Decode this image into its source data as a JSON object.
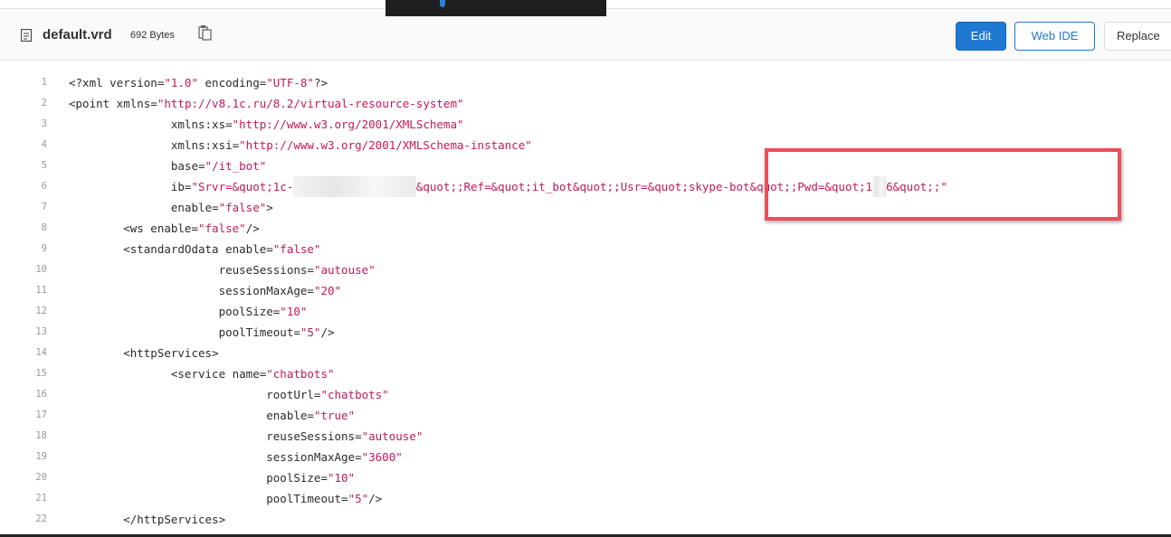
{
  "file": {
    "name": "default.vrd",
    "size": "692 Bytes",
    "icons": {
      "file": "file-icon",
      "copy": "copy-icon"
    }
  },
  "actions": {
    "edit": "Edit",
    "web_ide": "Web IDE",
    "replace": "Replace"
  },
  "colors": {
    "accent": "#1f78d1",
    "string": "#c2185b",
    "highlight": "#e8505b"
  },
  "lines": [
    {
      "n": "1",
      "t": "<?xml version=\"1.0\" encoding=\"UTF-8\"?>"
    },
    {
      "n": "2",
      "t": "<point xmlns=\"http://v8.1c.ru/8.2/virtual-resource-system\""
    },
    {
      "n": "3",
      "t": "               xmlns:xs=\"http://www.w3.org/2001/XMLSchema\""
    },
    {
      "n": "4",
      "t": "               xmlns:xsi=\"http://www.w3.org/2001/XMLSchema-instance\""
    },
    {
      "n": "5",
      "t": "               base=\"/it_bot\""
    },
    {
      "n": "6",
      "t": "               ib=\"Srvr=&quot;1c-"
    },
    {
      "n": "7",
      "t": "               enable=\"false\">"
    },
    {
      "n": "8",
      "t": "        <ws enable=\"false\"/>"
    },
    {
      "n": "9",
      "t": "        <standardOdata enable=\"false\""
    },
    {
      "n": "10",
      "t": "                      reuseSessions=\"autouse\""
    },
    {
      "n": "11",
      "t": "                      sessionMaxAge=\"20\""
    },
    {
      "n": "12",
      "t": "                      poolSize=\"10\""
    },
    {
      "n": "13",
      "t": "                      poolTimeout=\"5\"/>"
    },
    {
      "n": "14",
      "t": "        <httpServices>"
    },
    {
      "n": "15",
      "t": "               <service name=\"chatbots\""
    },
    {
      "n": "16",
      "t": "                             rootUrl=\"chatbots\""
    },
    {
      "n": "17",
      "t": "                             enable=\"true\""
    },
    {
      "n": "18",
      "t": "                             reuseSessions=\"autouse\""
    },
    {
      "n": "19",
      "t": "                             sessionMaxAge=\"3600\""
    },
    {
      "n": "20",
      "t": "                             poolSize=\"10\""
    },
    {
      "n": "21",
      "t": "                             poolTimeout=\"5\"/>"
    },
    {
      "n": "22",
      "t": "        </httpServices>"
    }
  ],
  "line6_rest": "&quot;;Ref=&quot;it_bot&quot;;Usr=&quot;skype-bot&quot;;Pwd=&quot;1",
  "line6_end": "6&quot;;\""
}
